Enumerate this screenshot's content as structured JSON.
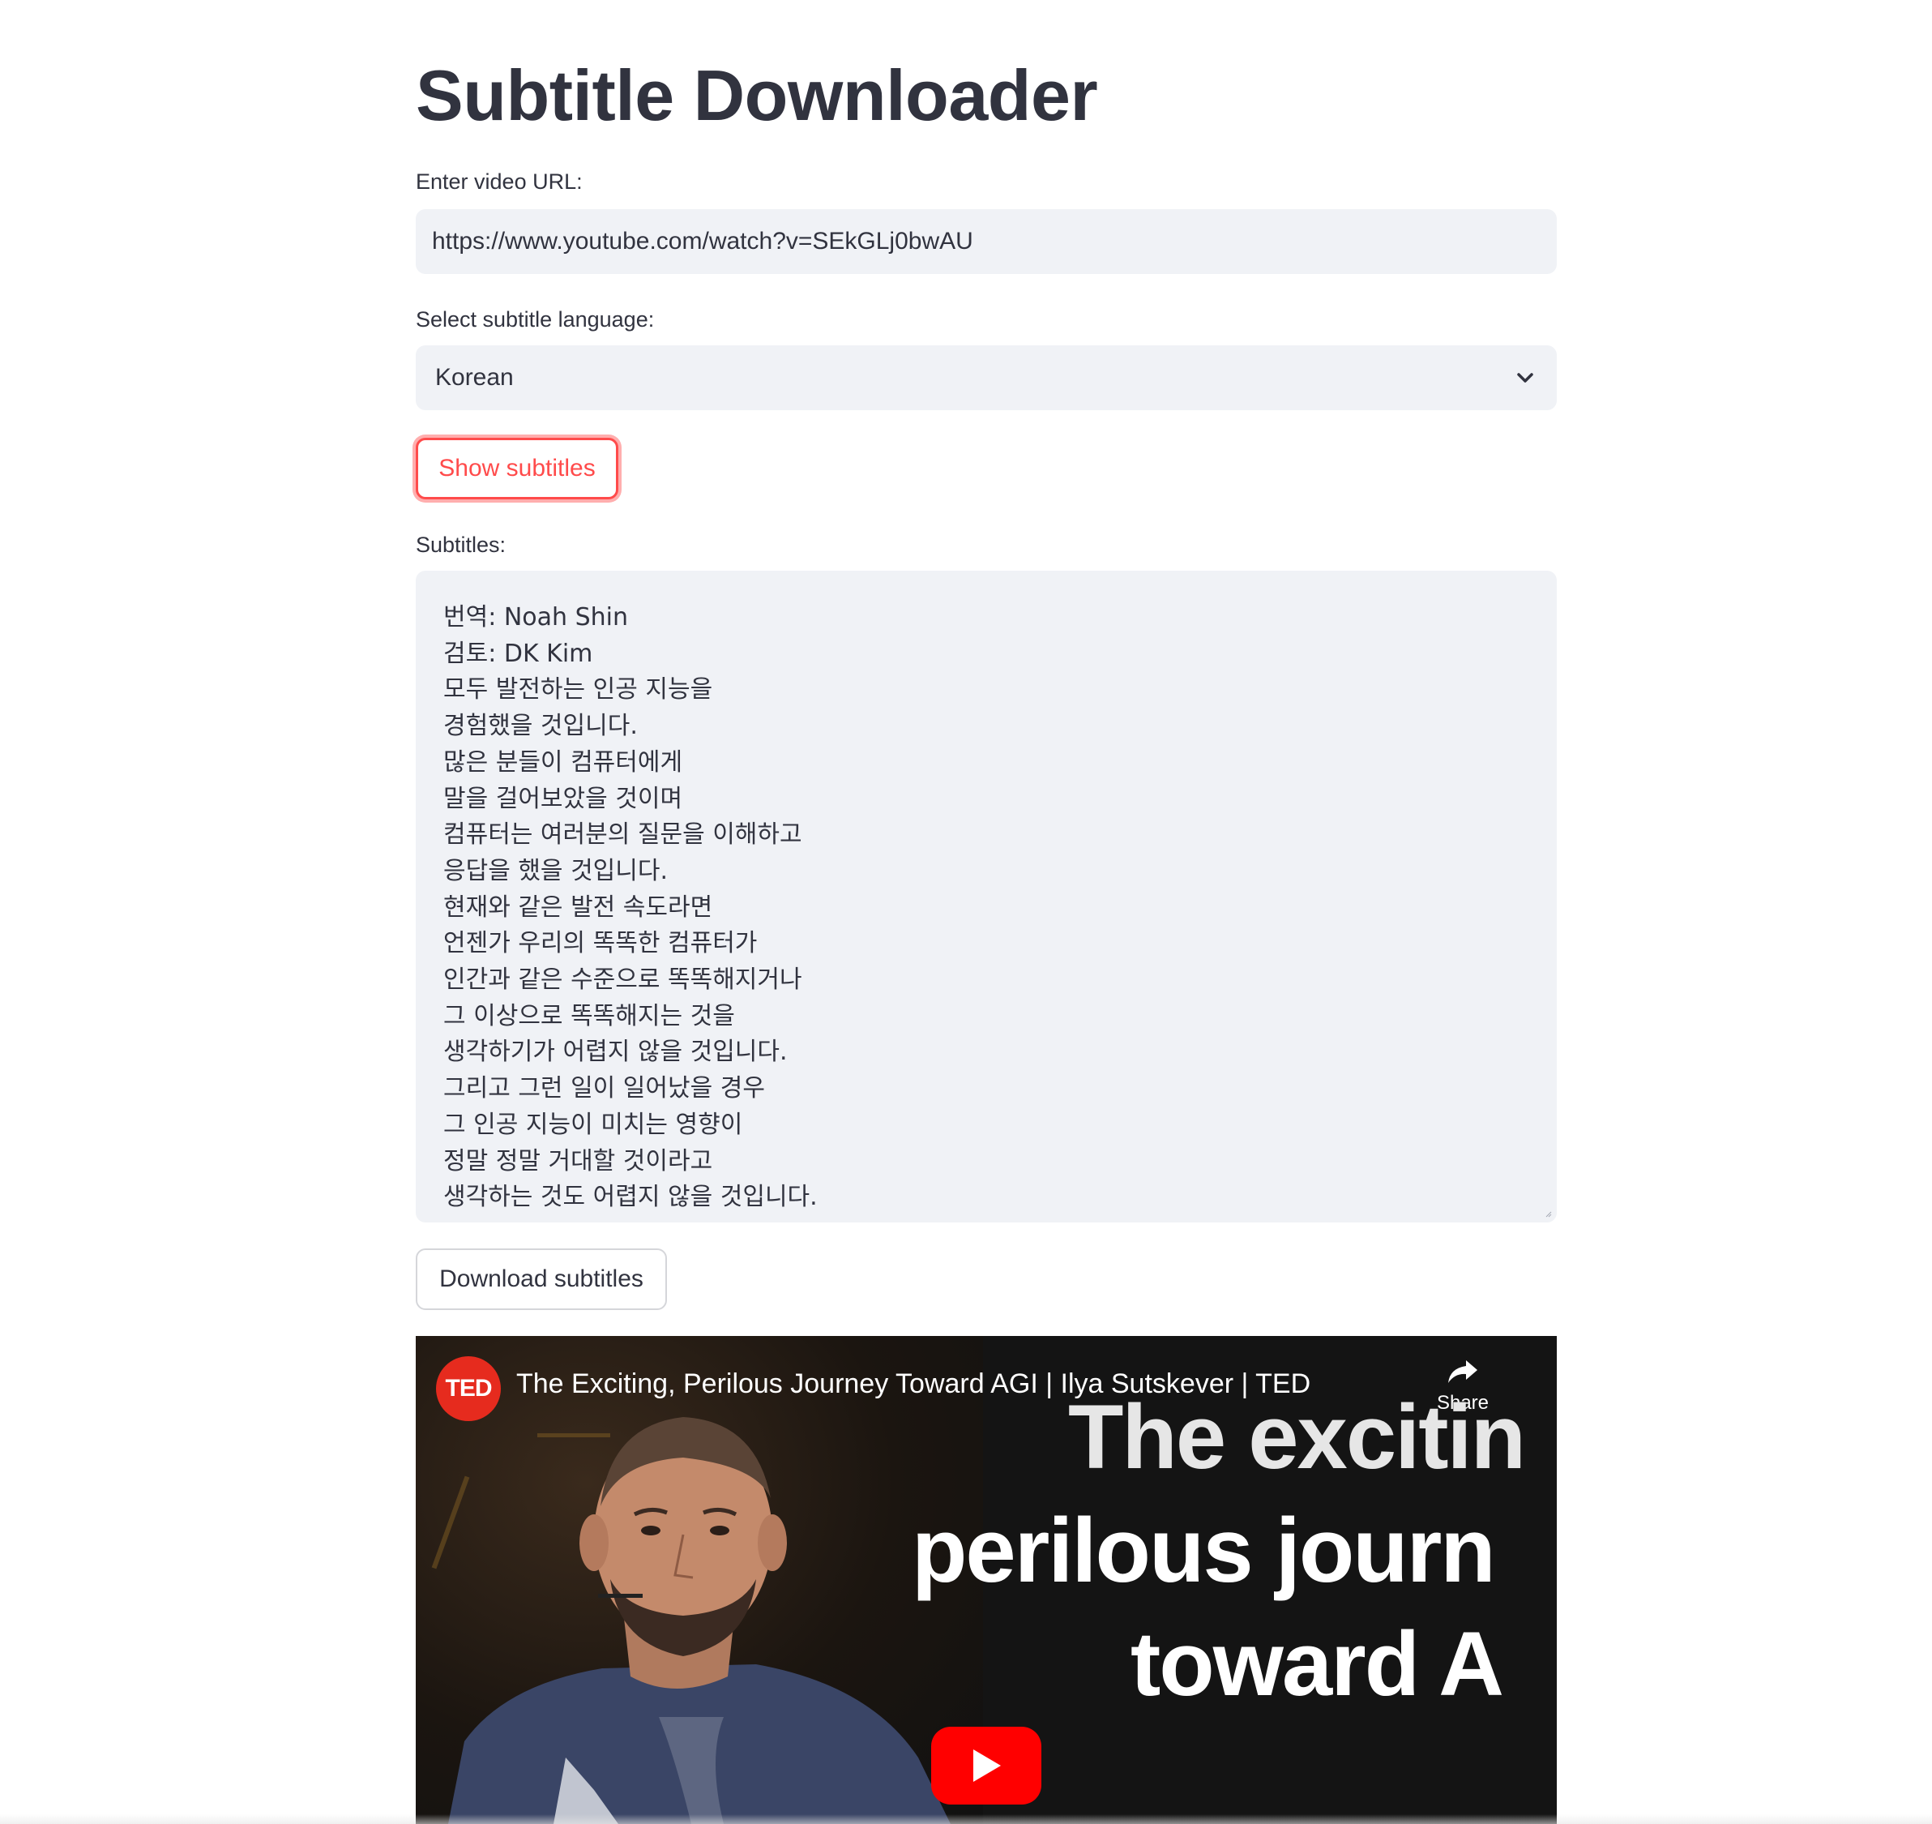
{
  "page": {
    "title": "Subtitle Downloader"
  },
  "url_field": {
    "label": "Enter video URL:",
    "value": "https://www.youtube.com/watch?v=SEkGLj0bwAU"
  },
  "language_select": {
    "label": "Select subtitle language:",
    "selected": "Korean",
    "icon": "chevron-down-icon"
  },
  "show_button": {
    "label": "Show subtitles",
    "accent_color": "#ff4b4b"
  },
  "subtitles": {
    "label": "Subtitles:",
    "lines": [
      "번역: Noah Shin",
      "검토: DK Kim",
      "모두 발전하는 인공 지능을",
      "경험했을 것입니다.",
      "많은 분들이 컴퓨터에게",
      "말을 걸어보았을 것이며",
      "컴퓨터는 여러분의 질문을 이해하고",
      "응답을 했을 것입니다.",
      "현재와 같은 발전 속도라면",
      "언젠가 우리의 똑똑한 컴퓨터가",
      "인간과 같은 수준으로 똑똑해지거나",
      "그 이상으로 똑똑해지는 것을",
      "생각하기가 어렵지 않을 것입니다.",
      "그리고 그런 일이 일어났을 경우",
      "그 인공 지능이 미치는 영향이",
      "정말 정말 거대할 것이라고",
      "생각하는 것도 어렵지 않을 것입니다."
    ]
  },
  "download_button": {
    "label": "Download subtitles"
  },
  "video": {
    "channel_logo": "TED",
    "title": "The Exciting, Perilous Journey Toward AGI | Ilya Sutskever | TED",
    "share_label": "Share",
    "overlay_lines": [
      "The excitin",
      "perilous journ",
      "toward A"
    ],
    "play_icon": "play-icon",
    "share_icon": "share-arrow-icon"
  },
  "colors": {
    "text": "#31333f",
    "input_bg": "#f0f2f6",
    "accent": "#ff4b4b",
    "ted_red": "#e62b1e",
    "youtube_red": "#ff0000"
  }
}
